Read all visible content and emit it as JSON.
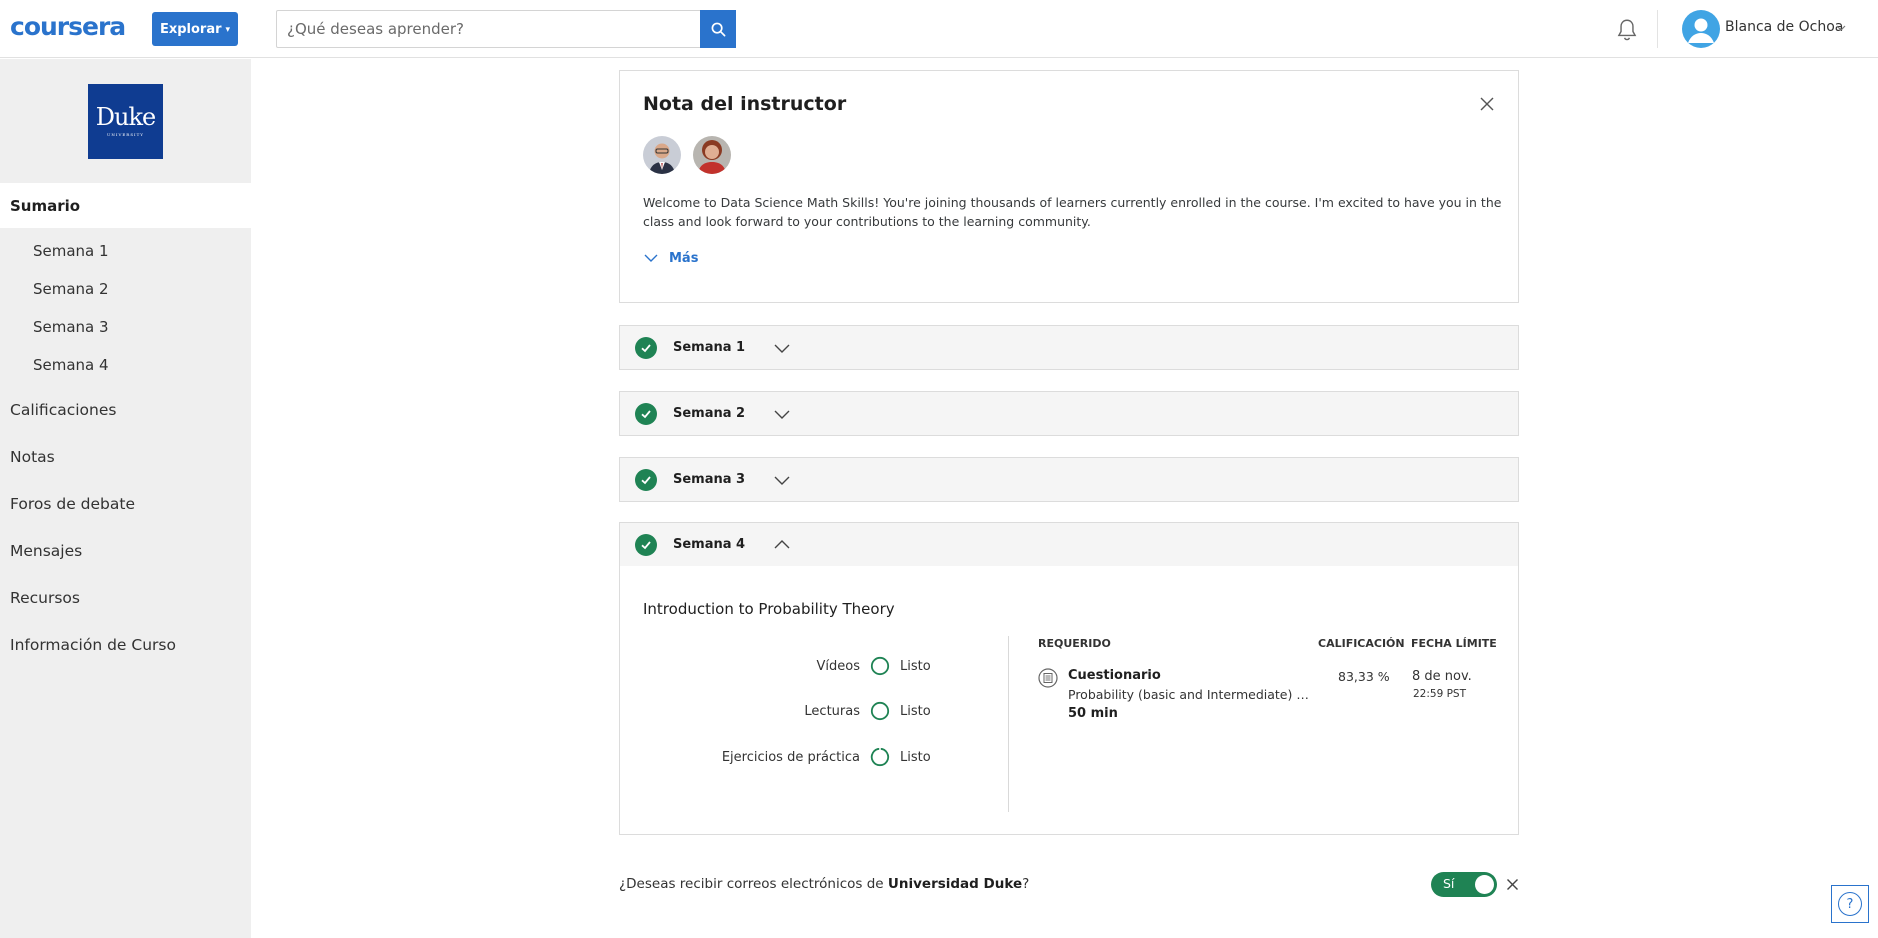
{
  "header": {
    "logo": "coursera",
    "explore_label": "Explorar",
    "search_placeholder": "¿Qué deseas aprender?",
    "user_name": "Blanca de Ochoa",
    "icons": [
      "search-icon",
      "bell-icon",
      "user-avatar-icon",
      "chevron-down-icon"
    ]
  },
  "sidebar": {
    "university_logo": {
      "line1": "Duke",
      "line2": "UNIVERSITY"
    },
    "summary_label": "Sumario",
    "weeks": [
      "Semana 1",
      "Semana 2",
      "Semana 3",
      "Semana 4"
    ],
    "items": [
      "Calificaciones",
      "Notas",
      "Foros de debate",
      "Mensajes",
      "Recursos",
      "Información de Curso"
    ]
  },
  "instructor_note": {
    "title": "Nota del instructor",
    "text": "Welcome to Data Science Math Skills! You're joining thousands of learners currently enrolled in the course. I'm excited to have you in the class and look forward to your contributions to the learning community.",
    "more_label": "Más"
  },
  "weeks": [
    {
      "label": "Semana 1",
      "completed": true,
      "expanded": false
    },
    {
      "label": "Semana 2",
      "completed": true,
      "expanded": false
    },
    {
      "label": "Semana 3",
      "completed": true,
      "expanded": false
    },
    {
      "label": "Semana 4",
      "completed": true,
      "expanded": true
    }
  ],
  "week4": {
    "topic": "Introduction to Probability Theory",
    "progress": [
      {
        "label": "Vídeos",
        "status": "Listo"
      },
      {
        "label": "Lecturas",
        "status": "Listo"
      },
      {
        "label": "Ejercicios de práctica",
        "status": "Listo"
      }
    ],
    "headers": {
      "required": "REQUERIDO",
      "grade": "CALIFICACIÓN",
      "due": "FECHA LÍMITE"
    },
    "assignment": {
      "type": "Cuestionario",
      "title": "Probability (basic and Intermediate) Graded Quiz",
      "duration": "50 min",
      "grade": "83,33 %",
      "due_date": "8 de nov.",
      "due_time": "22:59 PST"
    }
  },
  "email_prompt": {
    "text": "¿Deseas recibir correos electrónicos de ",
    "university": "Universidad Duke",
    "suffix": "?",
    "toggle_label": "Sí",
    "toggle_on": true
  },
  "help_label": "?",
  "colors": {
    "brand": "#2a73cc",
    "success": "#1f8354",
    "sidebar_bg": "#efefef",
    "duke_blue": "#0f3c91"
  }
}
